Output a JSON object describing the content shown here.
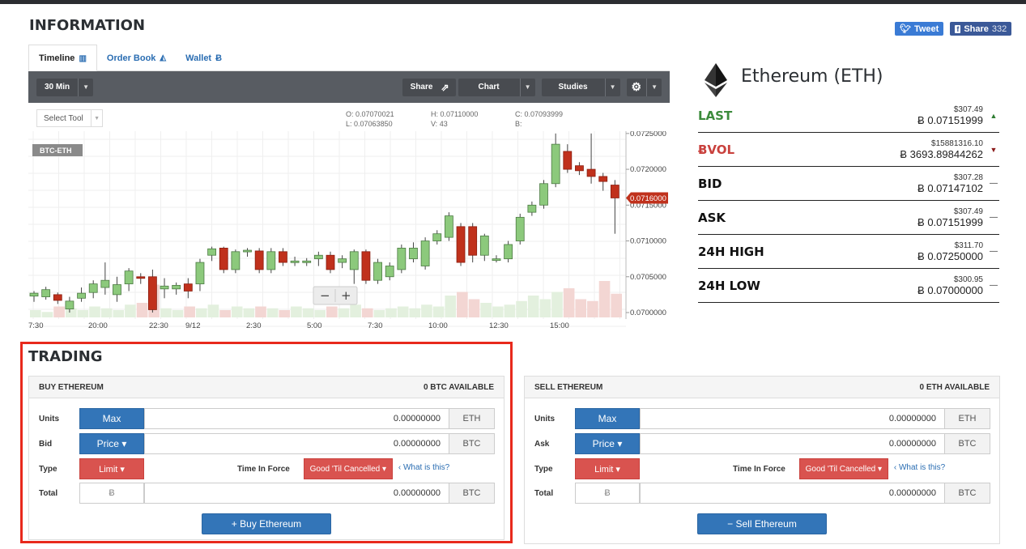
{
  "info": {
    "heading": "INFORMATION",
    "tabs": [
      {
        "label": "Timeline",
        "icon": "bar-chart-icon"
      },
      {
        "label": "Order Book",
        "icon": "area-chart-icon"
      },
      {
        "label": "Wallet",
        "icon": "bitcoin-icon"
      }
    ],
    "social": {
      "tweet": "Tweet",
      "share": "Share",
      "share_count": "332"
    }
  },
  "chart_toolbar": {
    "interval": "30 Min",
    "share": "Share",
    "chart": "Chart",
    "studies": "Studies",
    "select_tool": "Select Tool"
  },
  "ohlc": {
    "o_label": "O:",
    "o_value": "0.07070021",
    "h_label": "H:",
    "h_value": "0.07110000",
    "c_label": "C:",
    "c_value": "0.07093999",
    "l_label": "L:",
    "l_value": "0.07063850",
    "v_label": "V:",
    "v_value": "43",
    "b_label": "B:",
    "b_value": ""
  },
  "chart_data": {
    "type": "candlestick",
    "symbol": "BTC-ETH",
    "current_price": "0.0716000",
    "ylim": [
      0.07,
      0.0726
    ],
    "y_ticks": [
      "0.0725000",
      "0.0720000",
      "0.0715000",
      "0.0710000",
      "0.0705000",
      "0.0700000"
    ],
    "x_ticks": [
      "7:30",
      "20:00",
      "22:30",
      "9/12",
      "2:30",
      "5:00",
      "7:30",
      "10:00",
      "12:30",
      "15:00"
    ],
    "candles": [
      [
        0.07023,
        0.07027,
        0.07015,
        0.0703
      ],
      [
        0.07022,
        0.07032,
        0.07018,
        0.07036
      ],
      [
        0.07025,
        0.07017,
        0.07012,
        0.07028
      ],
      [
        0.07005,
        0.07016,
        0.07,
        0.07022
      ],
      [
        0.0702,
        0.07027,
        0.07015,
        0.07035
      ],
      [
        0.07028,
        0.0704,
        0.0702,
        0.07045
      ],
      [
        0.07035,
        0.07045,
        0.07025,
        0.0707
      ],
      [
        0.07025,
        0.07039,
        0.07015,
        0.0705
      ],
      [
        0.0704,
        0.07058,
        0.0703,
        0.07062
      ],
      [
        0.0705,
        0.07048,
        0.0704,
        0.07055
      ],
      [
        0.0705,
        0.07004,
        0.07,
        0.0706
      ],
      [
        0.07033,
        0.07037,
        0.0702,
        0.07048
      ],
      [
        0.07033,
        0.07038,
        0.07025,
        0.07042
      ],
      [
        0.0704,
        0.0703,
        0.0702,
        0.07048
      ],
      [
        0.0704,
        0.0707,
        0.0703,
        0.07075
      ],
      [
        0.0708,
        0.07089,
        0.07072,
        0.07092
      ],
      [
        0.0709,
        0.0706,
        0.07055,
        0.07092
      ],
      [
        0.0706,
        0.07085,
        0.07055,
        0.07088
      ],
      [
        0.07085,
        0.07087,
        0.07078,
        0.0709
      ],
      [
        0.07086,
        0.0706,
        0.07055,
        0.0709
      ],
      [
        0.0706,
        0.07085,
        0.07055,
        0.0709
      ],
      [
        0.07085,
        0.0707,
        0.07065,
        0.0709
      ],
      [
        0.0707,
        0.07072,
        0.07065,
        0.07078
      ],
      [
        0.0707,
        0.07072,
        0.07065,
        0.07076
      ],
      [
        0.07075,
        0.0708,
        0.07065,
        0.07085
      ],
      [
        0.0708,
        0.0706,
        0.07055,
        0.07085
      ],
      [
        0.0707,
        0.07075,
        0.07062,
        0.0708
      ],
      [
        0.0706,
        0.07085,
        0.0704,
        0.07088
      ],
      [
        0.07085,
        0.07045,
        0.0704,
        0.07088
      ],
      [
        0.07045,
        0.0707,
        0.0704,
        0.07075
      ],
      [
        0.0705,
        0.07065,
        0.07045,
        0.0707
      ],
      [
        0.0706,
        0.0709,
        0.07055,
        0.07095
      ],
      [
        0.07075,
        0.0709,
        0.0707,
        0.07098
      ],
      [
        0.07065,
        0.071,
        0.0706,
        0.07105
      ],
      [
        0.071,
        0.0711,
        0.07095,
        0.07115
      ],
      [
        0.07105,
        0.07135,
        0.071,
        0.0714
      ],
      [
        0.0712,
        0.0707,
        0.07065,
        0.07125
      ],
      [
        0.0712,
        0.0708,
        0.0707,
        0.07125
      ],
      [
        0.0708,
        0.07107,
        0.07072,
        0.0711
      ],
      [
        0.07075,
        0.07075,
        0.0707,
        0.0708
      ],
      [
        0.07075,
        0.07095,
        0.0707,
        0.071
      ],
      [
        0.071,
        0.07133,
        0.07095,
        0.07138
      ],
      [
        0.0714,
        0.0715,
        0.07135,
        0.07155
      ],
      [
        0.0715,
        0.0718,
        0.07145,
        0.07185
      ],
      [
        0.0718,
        0.07235,
        0.07175,
        0.0725
      ],
      [
        0.07225,
        0.072,
        0.07195,
        0.07235
      ],
      [
        0.07205,
        0.07198,
        0.07192,
        0.0721
      ],
      [
        0.072,
        0.0719,
        0.0718,
        0.0725
      ],
      [
        0.0719,
        0.07183,
        0.0717,
        0.07195
      ],
      [
        0.07178,
        0.0716,
        0.0711,
        0.07185
      ]
    ],
    "volumes": [
      4,
      3,
      6,
      5,
      4,
      6,
      5,
      4,
      7,
      8,
      18,
      5,
      4,
      6,
      5,
      7,
      4,
      6,
      5,
      6,
      5,
      4,
      6,
      5,
      4,
      6,
      5,
      7,
      5,
      4,
      5,
      6,
      5,
      7,
      6,
      12,
      14,
      10,
      8,
      6,
      7,
      9,
      12,
      10,
      14,
      16,
      10,
      9,
      20,
      13
    ]
  },
  "coin": {
    "name": "Ethereum (ETH)",
    "icon": "ethereum-icon"
  },
  "stats": [
    {
      "label": "LAST",
      "usd": "$307.49",
      "btc": "Ƀ 0.07151999",
      "trend": "up",
      "color": "#3c8b3c"
    },
    {
      "label": "ɃVOL",
      "usd": "$15881316.10",
      "btc": "Ƀ 3693.89844262",
      "trend": "down",
      "color": "#c9413d"
    },
    {
      "label": "BID",
      "usd": "$307.28",
      "btc": "Ƀ 0.07147102",
      "trend": "flat",
      "color": "#111111"
    },
    {
      "label": "ASK",
      "usd": "$307.49",
      "btc": "Ƀ 0.07151999",
      "trend": "flat",
      "color": "#111111"
    },
    {
      "label": "24H HIGH",
      "usd": "$311.70",
      "btc": "Ƀ 0.07250000",
      "trend": "flat",
      "color": "#111111"
    },
    {
      "label": "24H LOW",
      "usd": "$300.95",
      "btc": "Ƀ 0.07000000",
      "trend": "flat",
      "color": "#111111"
    }
  ],
  "trading": {
    "heading": "TRADING",
    "buy": {
      "title": "BUY ETHEREUM",
      "available": "0 BTC AVAILABLE",
      "units_label": "Units",
      "units_btn": "Max",
      "units_value": "0.00000000",
      "units_unit": "ETH",
      "bid_label": "Bid",
      "bid_btn": "Price ▾",
      "bid_value": "0.00000000",
      "bid_unit": "BTC",
      "type_label": "Type",
      "type_btn": "Limit ▾",
      "tif_label": "Time In Force",
      "tif_btn": "Good 'Til Cancelled ▾",
      "what_link": "What is this?",
      "total_label": "Total",
      "total_currency": "Ƀ",
      "total_value": "0.00000000",
      "total_unit": "BTC",
      "action": "+ Buy Ethereum"
    },
    "sell": {
      "title": "SELL ETHEREUM",
      "available": "0 ETH AVAILABLE",
      "units_label": "Units",
      "units_btn": "Max",
      "units_value": "0.00000000",
      "units_unit": "ETH",
      "ask_label": "Ask",
      "ask_btn": "Price ▾",
      "ask_value": "0.00000000",
      "ask_unit": "BTC",
      "type_label": "Type",
      "type_btn": "Limit ▾",
      "tif_label": "Time In Force",
      "tif_btn": "Good 'Til Cancelled ▾",
      "what_link": "What is this?",
      "total_label": "Total",
      "total_currency": "Ƀ",
      "total_value": "0.00000000",
      "total_unit": "BTC",
      "action": "− Sell Ethereum"
    }
  }
}
